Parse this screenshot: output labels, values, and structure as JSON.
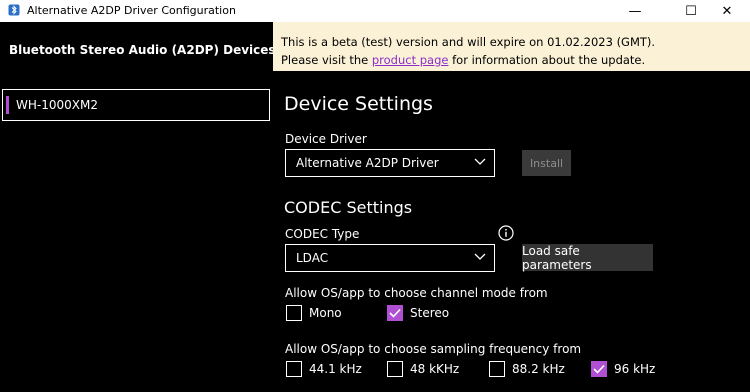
{
  "window": {
    "title": "Alternative A2DP Driver Configuration",
    "minimize": "—",
    "maximize": "☐",
    "close": "✕"
  },
  "sidebar": {
    "header": "Bluetooth Stereo Audio (A2DP) Devices",
    "devices": [
      {
        "label": "WH-1000XM2",
        "selected": true
      }
    ]
  },
  "banner": {
    "line1": "This is a beta (test) version and will expire on 01.02.2023 (GMT).",
    "line2_prefix": "Please visit the",
    "link": "product page",
    "line2_suffix": "for information about the update."
  },
  "device_settings": {
    "heading": "Device Settings",
    "driver_label": "Device Driver",
    "driver_value": "Alternative A2DP Driver",
    "install_label": "Install"
  },
  "codec_settings": {
    "heading": "CODEC Settings",
    "codec_type_label": "CODEC Type",
    "codec_value": "LDAC",
    "load_safe_label": "Load safe parameters"
  },
  "channel_mode": {
    "label": "Allow OS/app to choose channel mode from",
    "options": [
      {
        "label": "Mono",
        "checked": false
      },
      {
        "label": "Stereo",
        "checked": true
      }
    ]
  },
  "sampling": {
    "label": "Allow OS/app to choose sampling frequency from",
    "options": [
      {
        "label": "44.1 kHz",
        "checked": false
      },
      {
        "label": "48 kKHz",
        "checked": false
      },
      {
        "label": "88.2 kHz",
        "checked": false
      },
      {
        "label": "96 kHz",
        "checked": true
      }
    ]
  },
  "colors": {
    "accent": "#b04fd1",
    "banner_bg": "#fbf1d6",
    "link": "#8b2fc9"
  },
  "icons": {
    "app": "app-bluetooth-icon",
    "info": "info-icon",
    "chevron": "chevron-down-icon",
    "check": "checkmark-icon"
  }
}
